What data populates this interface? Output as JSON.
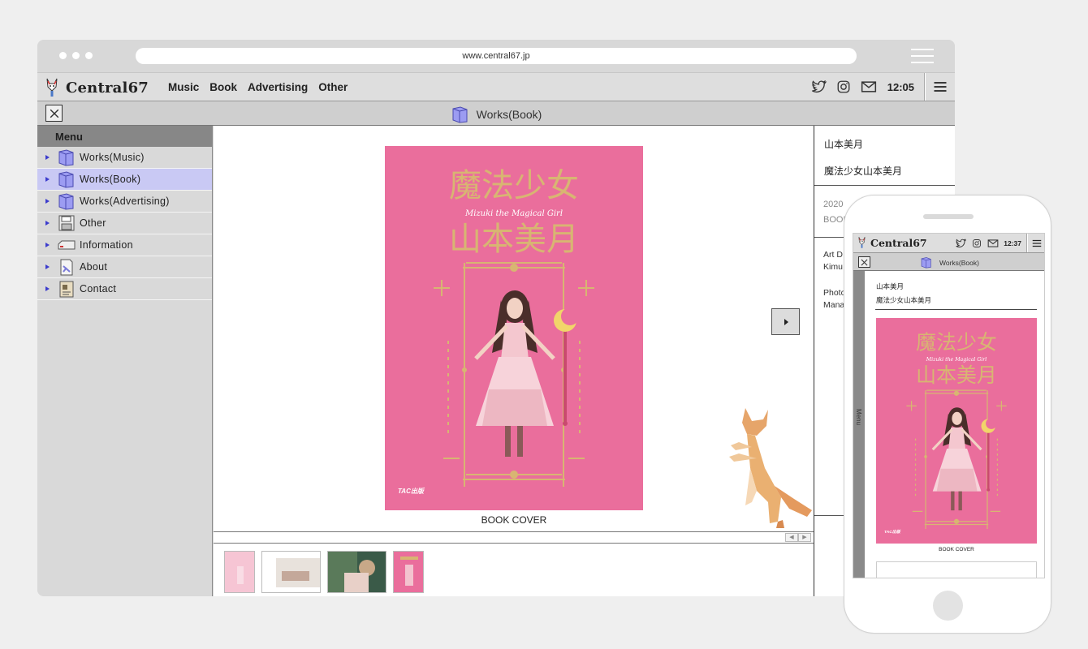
{
  "browser": {
    "url": "www.central67.jp"
  },
  "app": {
    "brand": "Central67",
    "nav": [
      "Music",
      "Book",
      "Advertising",
      "Other"
    ],
    "time": "12:05"
  },
  "window": {
    "title": "Works(Book)"
  },
  "sidebar": {
    "heading": "Menu",
    "items": [
      {
        "label": "Works(Music)",
        "icon": "folder-icon"
      },
      {
        "label": "Works(Book)",
        "icon": "folder-icon",
        "active": true
      },
      {
        "label": "Works(Advertising)",
        "icon": "folder-icon"
      },
      {
        "label": "Other",
        "icon": "floppy-disk-icon"
      },
      {
        "label": "Information",
        "icon": "drive-icon"
      },
      {
        "label": "About",
        "icon": "document-icon"
      },
      {
        "label": "Contact",
        "icon": "letter-icon"
      }
    ]
  },
  "viewer": {
    "caption": "BOOK COVER",
    "cover": {
      "title_line1": "魔法少女",
      "subtitle": "Mizuki the Magical Girl",
      "title_line2": "山本美月",
      "publisher": "TAC出版"
    }
  },
  "info": {
    "name": "山本美月",
    "book_title": "魔法少女山本美月",
    "year": "2020",
    "category": "BOOK",
    "credit1_role": "Art D",
    "credit1_name": "Kimu",
    "credit2_role": "Photo",
    "credit2_name": "Mana"
  },
  "phone": {
    "brand": "Central67",
    "time": "12:37",
    "title": "Works(Book)",
    "menu_label": "Menu",
    "name": "山本美月",
    "book_title": "魔法少女山本美月",
    "caption": "BOOK COVER"
  },
  "colors": {
    "cover_pink": "#ea6e9c",
    "cover_gold": "#d8b572",
    "active_item": "#c9c9f4",
    "folder_purple": "#8d8df0"
  }
}
